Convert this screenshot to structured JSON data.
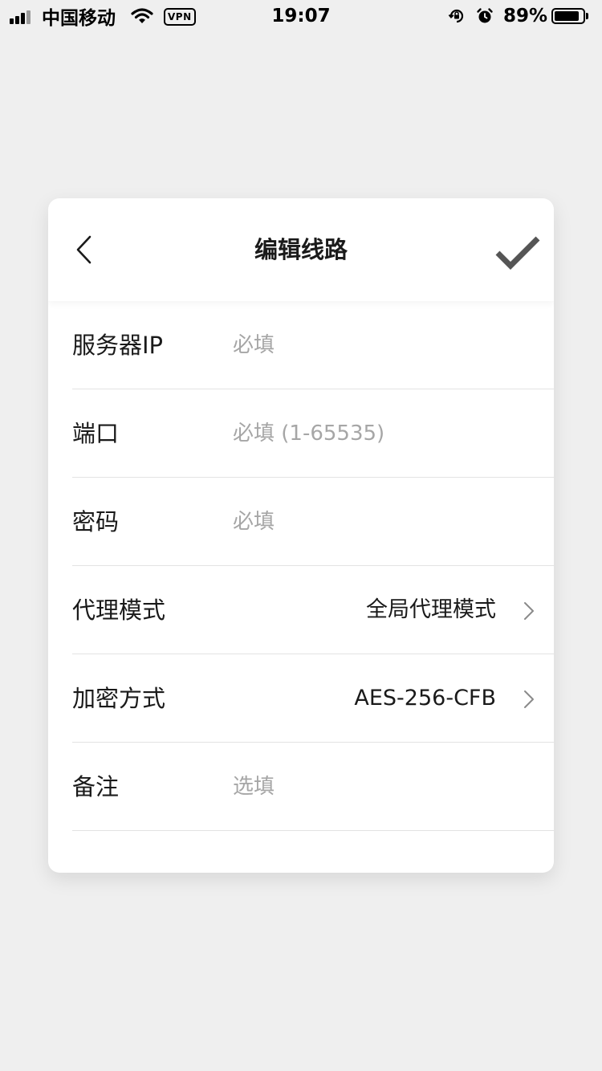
{
  "status_bar": {
    "carrier": "中国移动",
    "vpn": "VPN",
    "time": "19:07",
    "battery_percent": "89%",
    "battery_level": 0.89,
    "icons": [
      "signal-icon",
      "wifi-icon",
      "vpn-badge",
      "rotation-lock-icon",
      "alarm-icon",
      "battery-icon"
    ]
  },
  "header": {
    "title": "编辑线路",
    "back_icon": "chevron-left-icon",
    "confirm_icon": "checkmark-icon"
  },
  "form": {
    "server_ip": {
      "label": "服务器IP",
      "value": "",
      "placeholder": "必填"
    },
    "port": {
      "label": "端口",
      "value": "",
      "placeholder": "必填 (1-65535)"
    },
    "password": {
      "label": "密码",
      "value": "",
      "placeholder": "必填"
    },
    "proxy_mode": {
      "label": "代理模式",
      "value": "全局代理模式"
    },
    "encryption": {
      "label": "加密方式",
      "value": "AES-256-CFB"
    },
    "remark": {
      "label": "备注",
      "value": "",
      "placeholder": "选填"
    }
  },
  "colors": {
    "background": "#efefef",
    "card": "#ffffff",
    "text": "#1a1a1a",
    "placeholder": "#a6a6a6",
    "divider": "#e3e3e3",
    "checkmark": "#555555"
  }
}
